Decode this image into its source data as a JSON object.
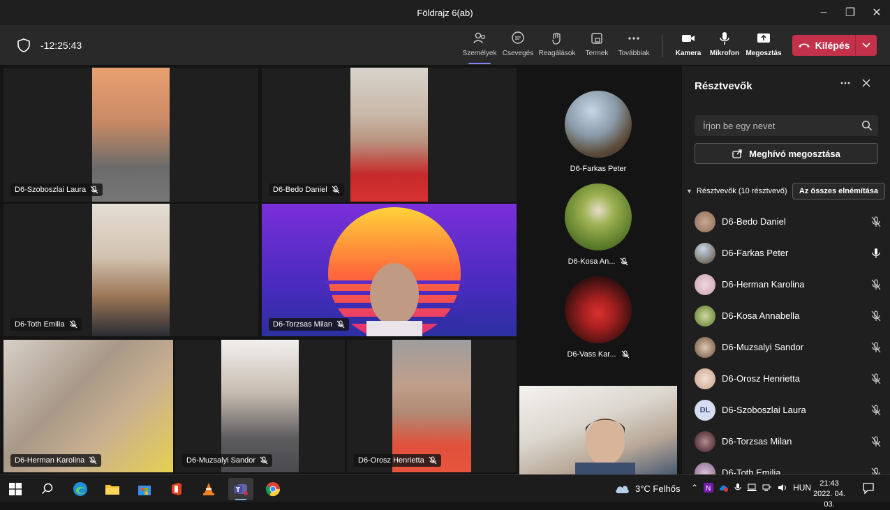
{
  "window": {
    "title": "Földrajz 6(ab)",
    "controls": [
      "–",
      "❐",
      "✕"
    ]
  },
  "toolbar": {
    "timer": "-12:25:43",
    "people_label": "Személyek",
    "chat_label": "Csevegés",
    "reactions_label": "Reagálások",
    "rooms_label": "Termek",
    "more_label": "Továbbiak",
    "camera_label": "Kamera",
    "mic_label": "Mikrofon",
    "share_label": "Megosztás",
    "leave_label": "Kilépés"
  },
  "tiles": [
    {
      "name": "D6-Szoboszlai Laura"
    },
    {
      "name": "D6-Bedo Daniel"
    },
    {
      "name": "D6-Toth Emilia"
    },
    {
      "name": "D6-Torzsas Milan"
    },
    {
      "name": "D6-Herman Karolina"
    },
    {
      "name": "D6-Muzsalyi Sandor"
    },
    {
      "name": "D6-Orosz Henrietta"
    }
  ],
  "side_avatars": [
    {
      "name": "D6-Farkas Peter"
    },
    {
      "name": "D6-Kosa An..."
    },
    {
      "name": "D6-Vass Kar..."
    }
  ],
  "panel": {
    "title": "Résztvevők",
    "search_placeholder": "Írjon be egy nevet",
    "invite_label": "Meghívó megosztása",
    "section_label": "Résztvevők (10 résztvevő)",
    "mute_all_label": "Az összes elnémítása",
    "participants": [
      {
        "name": "D6-Bedo Daniel",
        "mic": "muted"
      },
      {
        "name": "D6-Farkas Peter",
        "mic": "on"
      },
      {
        "name": "D6-Herman Karolina",
        "mic": "muted"
      },
      {
        "name": "D6-Kosa Annabella",
        "mic": "muted"
      },
      {
        "name": "D6-Muzsalyi Sandor",
        "mic": "muted"
      },
      {
        "name": "D6-Orosz Henrietta",
        "mic": "muted"
      },
      {
        "name": "D6-Szoboszlai Laura",
        "mic": "muted",
        "initials": "DL"
      },
      {
        "name": "D6-Torzsas Milan",
        "mic": "muted"
      },
      {
        "name": "D6-Toth Emilia",
        "mic": "muted"
      }
    ]
  },
  "taskbar": {
    "weather": "3°C  Felhős",
    "lang": "HUN",
    "time": "21:43",
    "date": "2022. 04. 03."
  },
  "colors": {
    "leave": "#c4314b",
    "accent": "#7f85f5",
    "panel_bg": "#1f1f1f"
  }
}
